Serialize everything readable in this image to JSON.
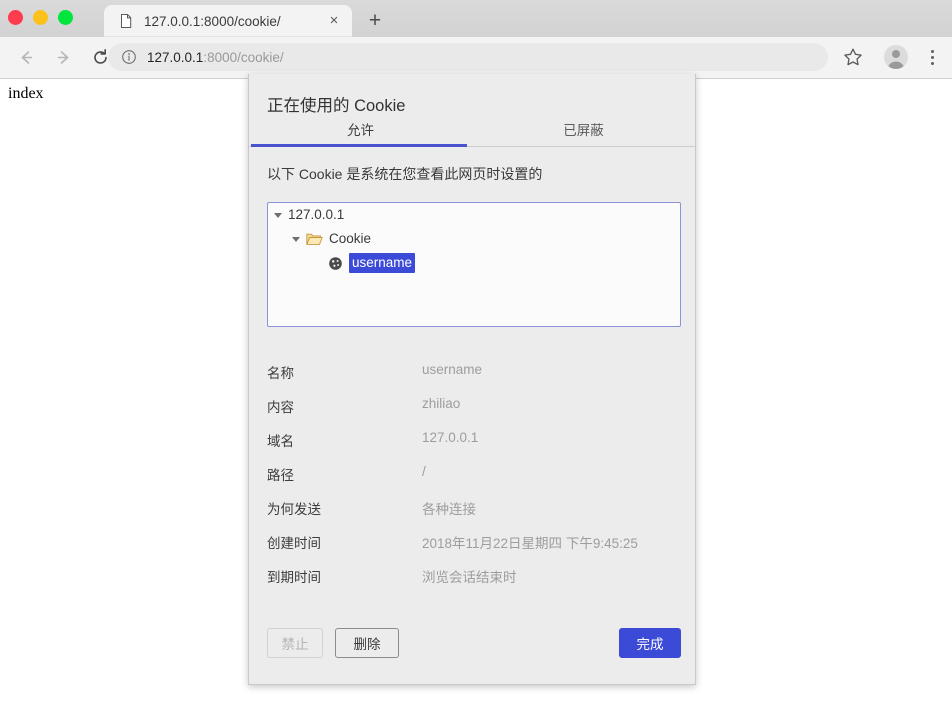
{
  "window": {
    "traffic_lights": [
      {
        "name": "close",
        "color": "#ff3b4e"
      },
      {
        "name": "minimize",
        "color": "#fcc21b"
      },
      {
        "name": "zoom",
        "color": "#00e63c"
      }
    ]
  },
  "browser": {
    "tab": {
      "title": "127.0.0.1:8000/cookie/",
      "favicon": "document-icon",
      "close_label": "×"
    },
    "new_tab_label": "+",
    "nav": {
      "back": "back-arrow-icon",
      "forward": "forward-arrow-icon",
      "reload": "reload-icon"
    },
    "omnibox": {
      "info_icon": "info-circle-icon",
      "host": "127.0.0.1",
      "path": ":8000/cookie/"
    },
    "actions": {
      "bookmark": "star-icon",
      "profile": "avatar-icon",
      "menu": "three-dot-menu-icon"
    }
  },
  "page": {
    "body_text": "index"
  },
  "dialog": {
    "title": "正在使用的 Cookie",
    "tabs": [
      {
        "label": "允许",
        "active": true
      },
      {
        "label": "已屏蔽",
        "active": false
      }
    ],
    "subtitle": "以下 Cookie 是系统在您查看此网页时设置的",
    "accent_color": "#3c4ad8",
    "tree": {
      "root": "127.0.0.1",
      "group": "Cookie",
      "item": "username",
      "item_selected": true
    },
    "details": [
      {
        "label": "名称",
        "value": "username"
      },
      {
        "label": "内容",
        "value": "zhiliao"
      },
      {
        "label": "域名",
        "value": "127.0.0.1"
      },
      {
        "label": "路径",
        "value": "/"
      },
      {
        "label": "为何发送",
        "value": "各种连接"
      },
      {
        "label": "创建时间",
        "value": "2018年11月22日星期四 下午9:45:25"
      },
      {
        "label": "到期时间",
        "value": "浏览会话结束时"
      }
    ],
    "buttons": {
      "block": "禁止",
      "delete": "删除",
      "done": "完成"
    }
  }
}
